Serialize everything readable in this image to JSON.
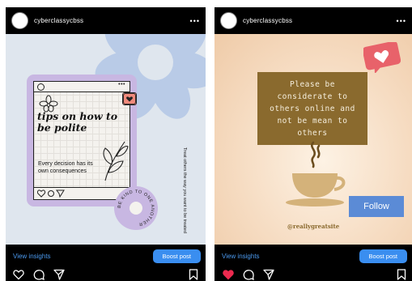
{
  "posts": [
    {
      "username": "cyberclassycbss",
      "more_label": "•••",
      "image": {
        "title": "tips on how to be polite",
        "subtitle": "Every decision has its own consequences",
        "circle_text": "BE KIND TO ONE ANOTHER",
        "side_text": "Treat others the way you want to be treated"
      },
      "insights": {
        "view_label": "View insights",
        "boost_label": "Boost post"
      },
      "liked": false
    },
    {
      "username": "cyberclassycbss",
      "more_label": "•••",
      "image": {
        "quote": "Please be considerate to others online and not be mean to others",
        "follow_label": "Follow",
        "handle": "@reallygreatsite"
      },
      "insights": {
        "view_label": "View insights",
        "boost_label": "Boost post"
      },
      "liked": true
    }
  ],
  "colors": {
    "accent_blue": "#3a8ef0",
    "link_blue": "#4c9bf0",
    "like_red": "#ed2a4f",
    "lavender": "#c8b7e2",
    "coffee_brown": "#8a6a2e"
  },
  "icons": [
    "heart-icon",
    "comment-icon",
    "share-icon",
    "bookmark-icon",
    "more-icon",
    "coffee-cup-icon",
    "notification-heart-icon",
    "flower-icon",
    "leaf-icon"
  ]
}
